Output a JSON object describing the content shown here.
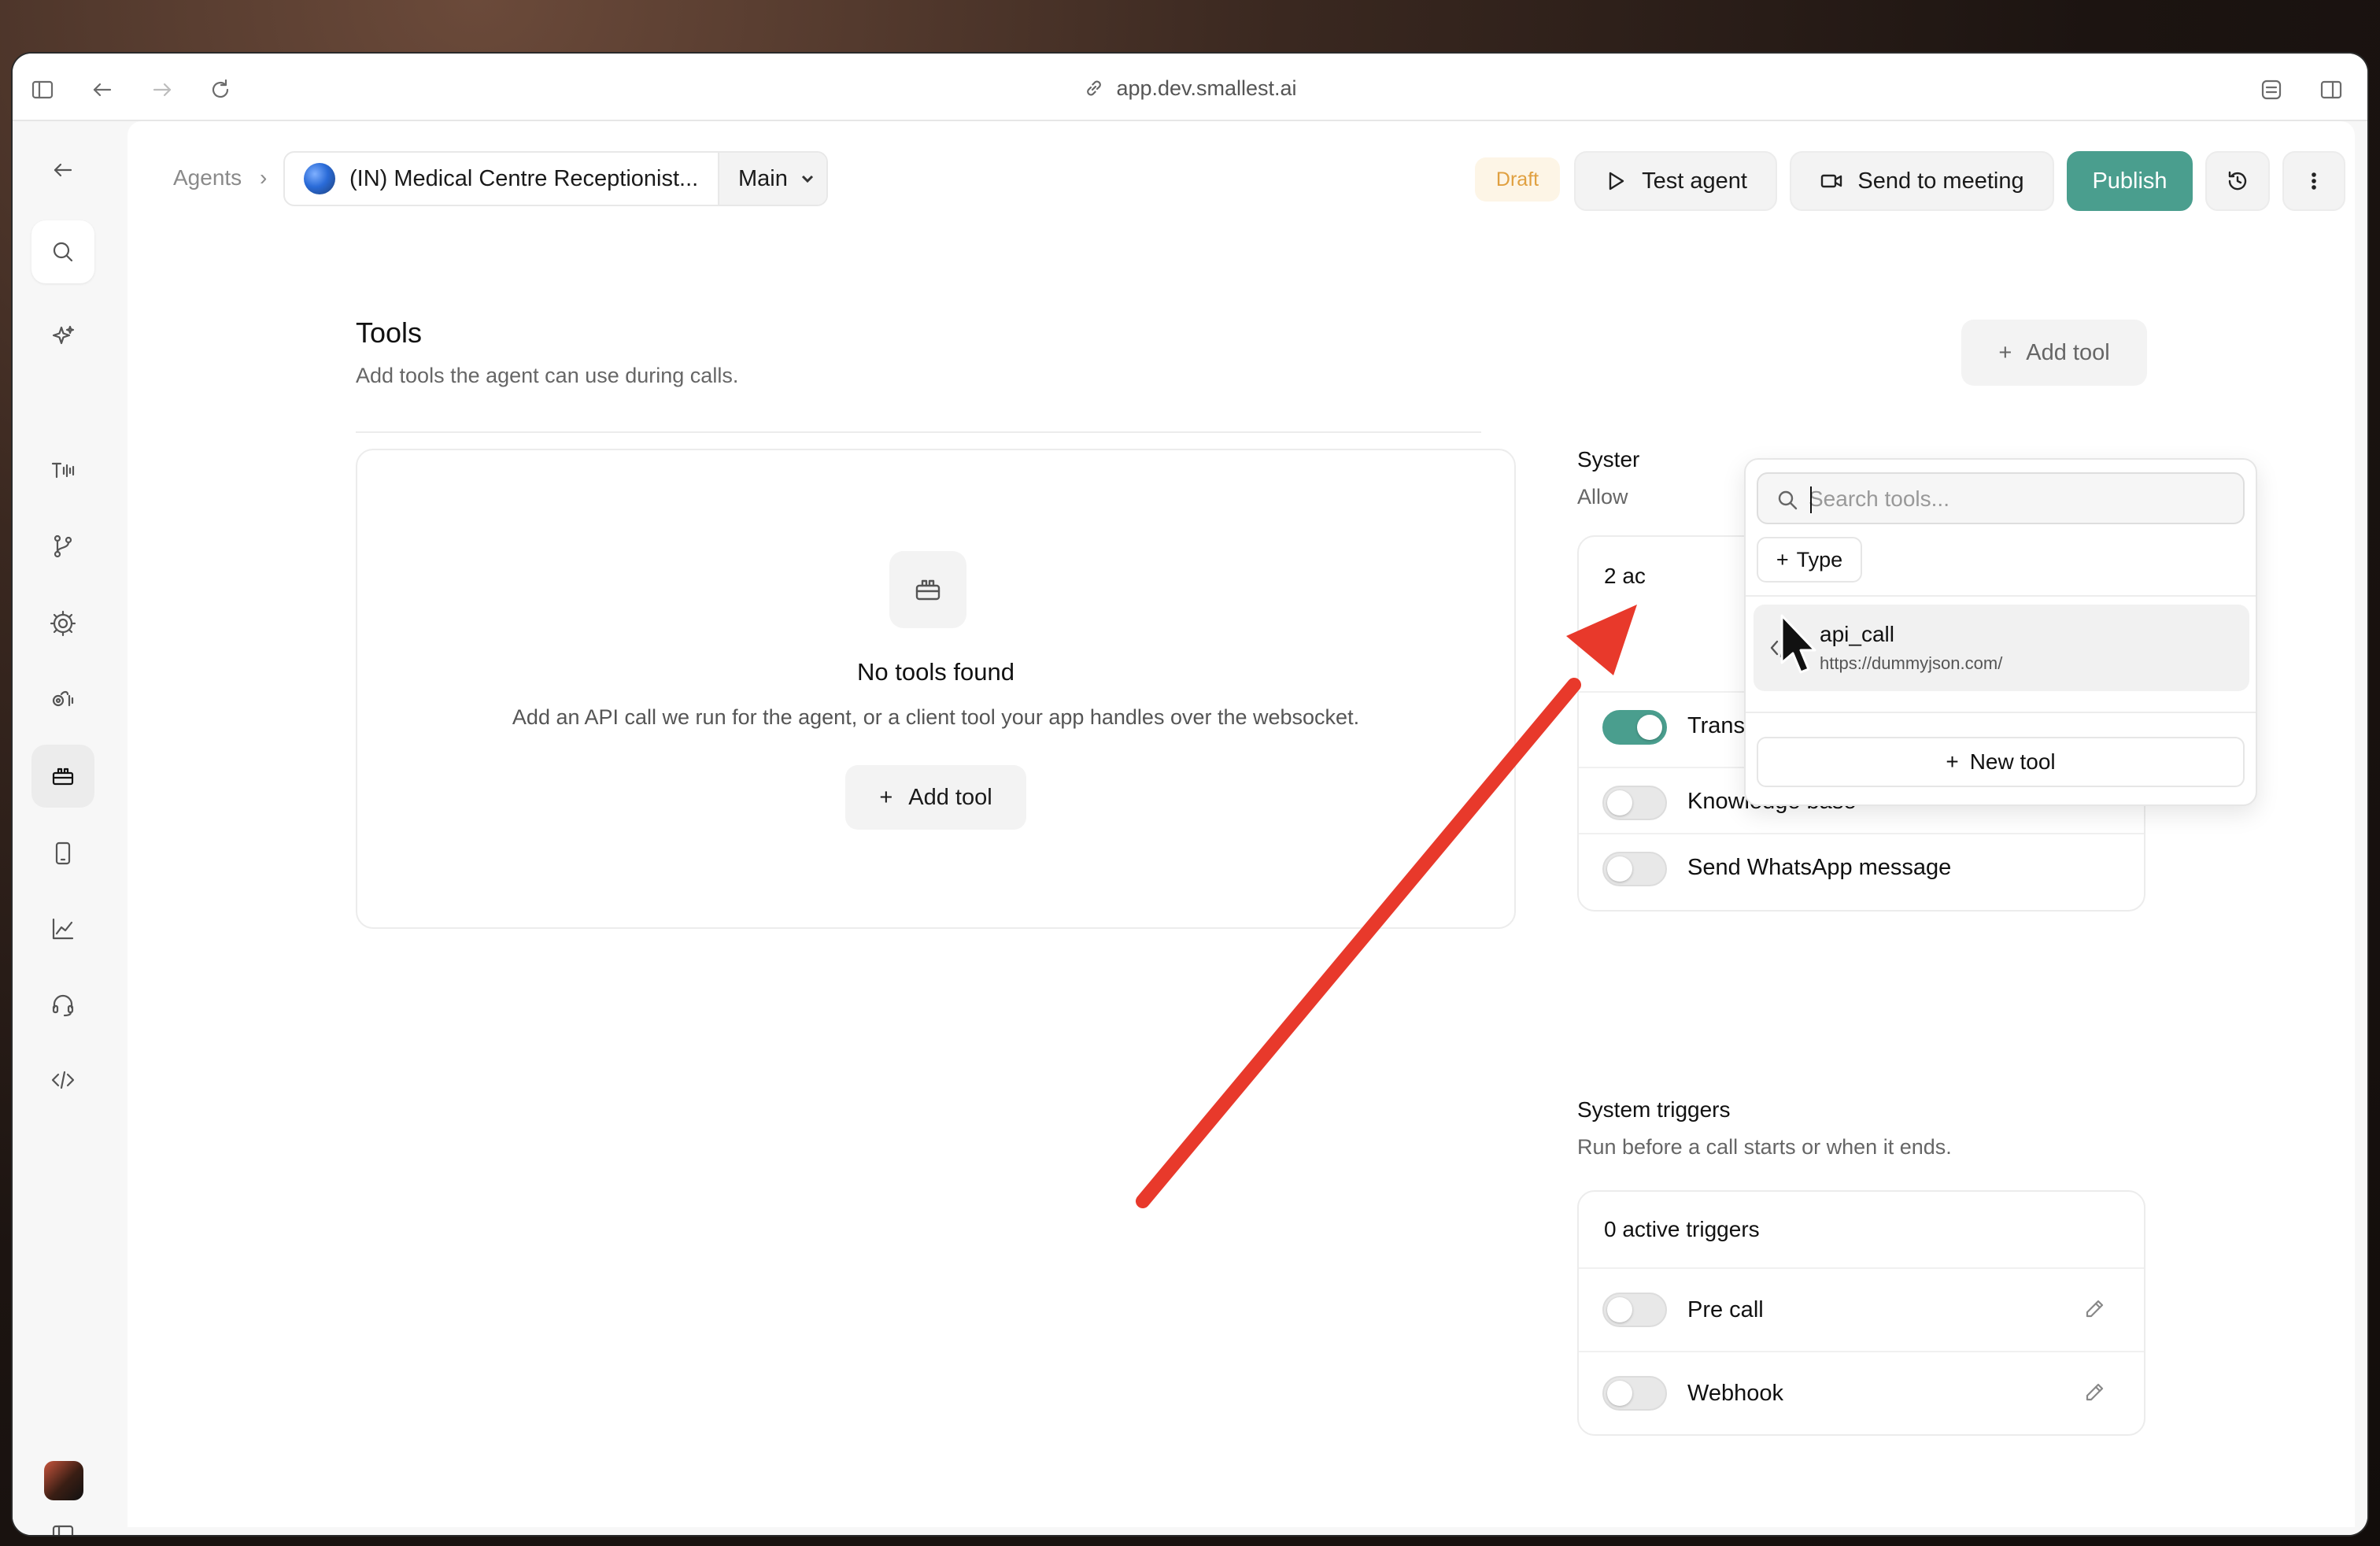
{
  "browser": {
    "url": "app.dev.smallest.ai"
  },
  "header": {
    "breadcrumb_root": "Agents",
    "breadcrumb_sep": "›",
    "agent_name": "(IN) Medical Centre Receptionist...",
    "branch": "Main",
    "status_badge": "Draft",
    "test_agent": "Test agent",
    "send_meeting": "Send to meeting",
    "publish": "Publish"
  },
  "tools": {
    "title": "Tools",
    "subtitle": "Add tools the agent can use during calls.",
    "add_tool": "Add tool",
    "empty_title": "No tools found",
    "empty_desc": "Add an API call we run for the agent, or a client tool your app handles over the websocket.",
    "empty_add": "Add tool"
  },
  "system_tools": {
    "title": "Syster",
    "subtitle": "Allow",
    "count": "2 ac",
    "items": [
      {
        "label": "Transfer call",
        "enabled": true
      },
      {
        "label": "Knowledge base",
        "enabled": false
      },
      {
        "label": "Send WhatsApp message",
        "enabled": false
      }
    ]
  },
  "system_triggers": {
    "title": "System triggers",
    "subtitle": "Run before a call starts or when it ends.",
    "count": "0 active triggers",
    "items": [
      {
        "label": "Pre call",
        "enabled": false
      },
      {
        "label": "Webhook",
        "enabled": false
      }
    ]
  },
  "dropdown": {
    "search_placeholder": "Search tools...",
    "type_filter": "Type",
    "item_name": "api_call",
    "item_url": "https://dummyjson.com/",
    "new_tool": "New tool"
  },
  "colors": {
    "accent": "#4a9e8e",
    "draft_text": "#e0a040",
    "annotation_arrow": "#e8392b"
  }
}
